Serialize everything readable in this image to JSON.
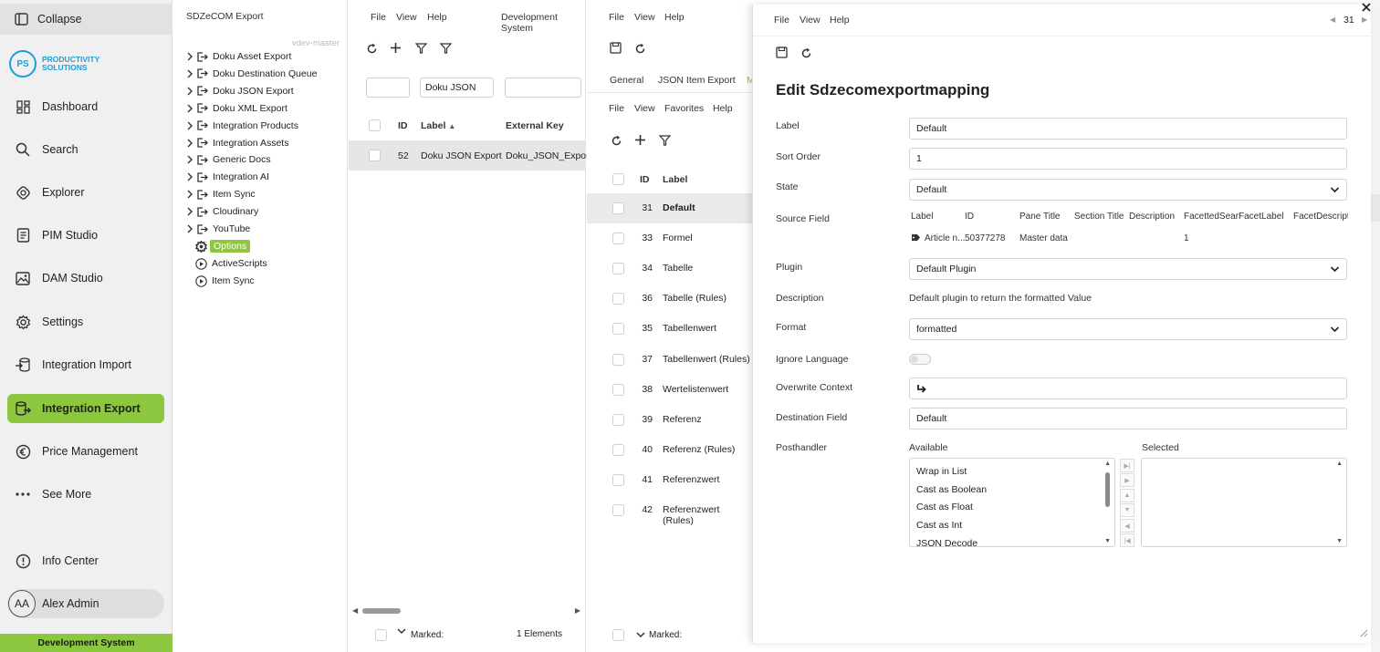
{
  "nav": {
    "collapse": "Collapse",
    "logo": {
      "line1": "PRODUCTIVITY",
      "line2": "SOLUTIONS",
      "badge": "PS"
    },
    "items": [
      {
        "label": "Dashboard",
        "icon": "dashboard-icon"
      },
      {
        "label": "Search",
        "icon": "search-icon"
      },
      {
        "label": "Explorer",
        "icon": "explorer-icon"
      },
      {
        "label": "PIM Studio",
        "icon": "pim-studio-icon"
      },
      {
        "label": "DAM Studio",
        "icon": "dam-studio-icon"
      },
      {
        "label": "Settings",
        "icon": "gear-icon"
      },
      {
        "label": "Integration Import",
        "icon": "import-icon"
      },
      {
        "label": "Integration Export",
        "icon": "export-icon"
      },
      {
        "label": "Price Management",
        "icon": "euro-icon"
      },
      {
        "label": "See More",
        "icon": "more-icon"
      }
    ],
    "info_center": "Info Center",
    "user": {
      "initials": "AA",
      "name": "Alex Admin"
    },
    "system": "Development System"
  },
  "tree": {
    "title": "SDZeCOM Export",
    "branch": "vdev-master",
    "items": [
      "Doku Asset Export",
      "Doku Destination Queue",
      "Doku JSON Export",
      "Doku XML Export",
      "Integration Products",
      "Integration Assets",
      "Generic Docs",
      "Integration AI",
      "Item Sync",
      "Cloudinary",
      "YouTube"
    ],
    "options": "Options",
    "leaves": [
      "ActiveScripts",
      "Item Sync"
    ]
  },
  "list": {
    "menu": [
      "File",
      "View",
      "Help"
    ],
    "system": "Development System",
    "filter_label": "Doku JSON",
    "headers": {
      "id": "ID",
      "label": "Label",
      "sort": "▲",
      "external_key": "External Key"
    },
    "rows": [
      {
        "id": "52",
        "label": "Doku JSON Export",
        "external_key": "Doku_JSON_Export"
      }
    ],
    "footer": {
      "marked": "Marked:",
      "count": "1 Elements"
    }
  },
  "mapping": {
    "menu": [
      "File",
      "View",
      "Help"
    ],
    "tabs": [
      "General",
      "JSON Item Export",
      "M"
    ],
    "submenu": [
      "File",
      "View",
      "Favorites",
      "Help"
    ],
    "headers": {
      "id": "ID",
      "label": "Label"
    },
    "rows": [
      {
        "id": "31",
        "label": "Default"
      },
      {
        "id": "33",
        "label": "Formel"
      },
      {
        "id": "34",
        "label": "Tabelle"
      },
      {
        "id": "36",
        "label": "Tabelle (Rules)"
      },
      {
        "id": "35",
        "label": "Tabellenwert"
      },
      {
        "id": "37",
        "label": "Tabellenwert (Rules)"
      },
      {
        "id": "38",
        "label": "Wertelistenwert"
      },
      {
        "id": "39",
        "label": "Referenz"
      },
      {
        "id": "40",
        "label": "Referenz (Rules)"
      },
      {
        "id": "41",
        "label": "Referenzwert"
      },
      {
        "id": "42",
        "label": "Referenzwert (Rules)"
      }
    ],
    "footer": {
      "marked": "Marked:"
    }
  },
  "form": {
    "menu": [
      "File",
      "View",
      "Help"
    ],
    "record_id": "31",
    "title": "Edit Sdzecomexportmapping",
    "fields": {
      "label": {
        "label": "Label",
        "value": "Default"
      },
      "sort_order": {
        "label": "Sort Order",
        "value": "1"
      },
      "state": {
        "label": "State",
        "value": "Default"
      },
      "source_field": {
        "label": "Source Field",
        "columns": [
          "Label",
          "ID",
          "Pane Title",
          "Section Title",
          "Description",
          "FacettedSear",
          "FacetLabel",
          "FacetDescript"
        ],
        "row": {
          "label": "Article n...",
          "id": "50377278",
          "pane_title": "Master data",
          "facetted": "1"
        }
      },
      "plugin": {
        "label": "Plugin",
        "value": "Default Plugin"
      },
      "description": {
        "label": "Description",
        "value": "Default plugin to return the formatted Value"
      },
      "format": {
        "label": "Format",
        "value": "formatted"
      },
      "ignore_language": {
        "label": "Ignore Language"
      },
      "overwrite_context": {
        "label": "Overwrite Context"
      },
      "destination_field": {
        "label": "Destination Field",
        "value": "Default"
      },
      "posthandler": {
        "label": "Posthandler",
        "available_label": "Available",
        "selected_label": "Selected",
        "available": [
          "Wrap in List",
          "Cast as Boolean",
          "Cast as Float",
          "Cast as Int",
          "JSON Decode"
        ]
      }
    }
  },
  "colors": {
    "accent": "#8dc63f",
    "brand": "#1aa0d8"
  }
}
